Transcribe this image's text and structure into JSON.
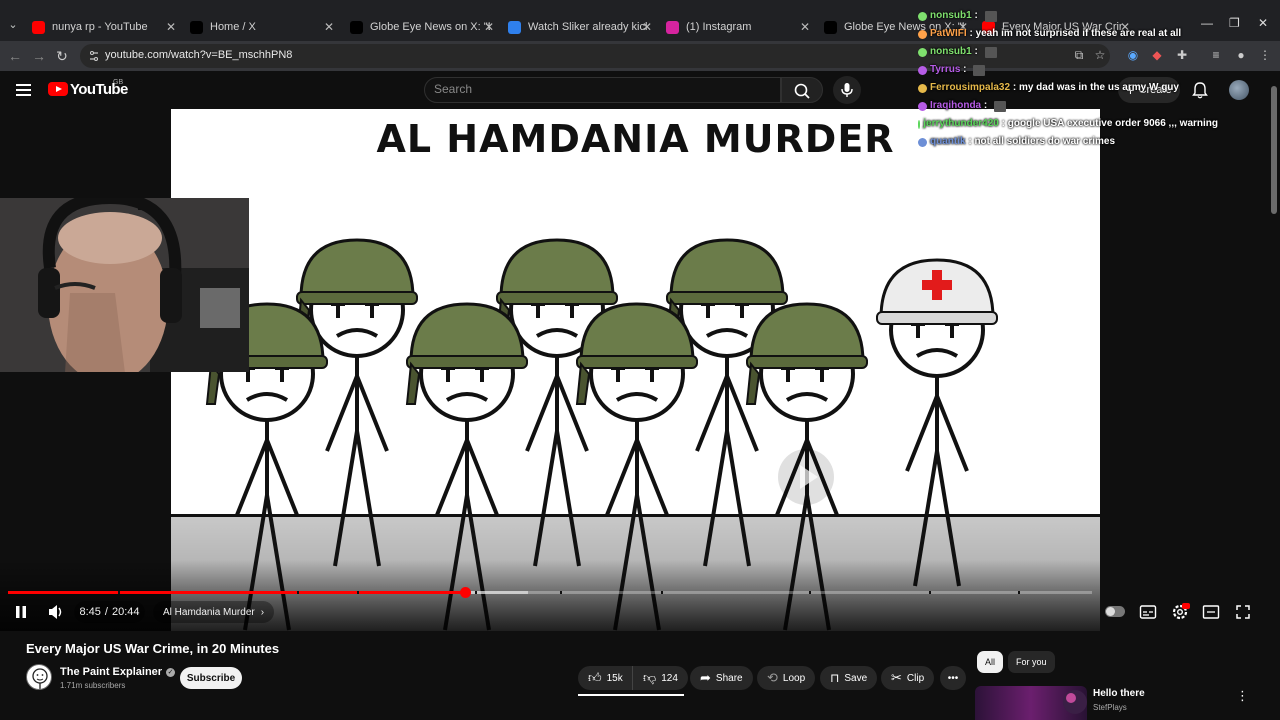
{
  "browser": {
    "tabs": [
      {
        "label": "nunya rp - YouTube",
        "icon": "youtube-icon",
        "color": "#ff0000"
      },
      {
        "label": "Home / X",
        "icon": "x-icon",
        "color": "#000000"
      },
      {
        "label": "Globe Eye News on X: \"BREAKI",
        "icon": "x-icon",
        "color": "#000000"
      },
      {
        "label": "Watch Sliker already kicked out",
        "icon": "kick-icon",
        "color": "#2f80ed"
      },
      {
        "label": "(1) Instagram",
        "icon": "instagram-icon",
        "color": "#d6249f"
      },
      {
        "label": "Globe Eye News on X: \"Preside",
        "icon": "x-icon",
        "color": "#000000"
      },
      {
        "label": "Every Major US War Crime",
        "icon": "youtube-icon",
        "color": "#ff0000"
      }
    ],
    "url": "youtube.com/watch?v=BE_mschhPN8"
  },
  "youtube": {
    "logo_text": "YouTube",
    "country_code": "GB",
    "search_placeholder": "Search",
    "create_label": "Create"
  },
  "video": {
    "frame_title": "AL HAMDANIA MURDER",
    "time_current": "8:45",
    "time_separator": "/",
    "time_total": "20:44",
    "chapter": "Al Hamdania Murder",
    "progress_fraction": 0.4218,
    "buffered_fraction": 0.48,
    "accent": "#ff0000"
  },
  "chat": [
    {
      "user": "nonsub1",
      "color": "#7fe06e",
      "message": "",
      "emote": true
    },
    {
      "user": "PatWIFI",
      "color": "#ffa24a",
      "message": "yeah im not surprised if these are real at all",
      "emote": false
    },
    {
      "user": "nonsub1",
      "color": "#7fe06e",
      "message": "",
      "emote": true
    },
    {
      "user": "Tyrrus",
      "color": "#b65ce6",
      "message": "",
      "emote": true
    },
    {
      "user": "Ferrousimpala32",
      "color": "#e6b94a",
      "message": "my dad was in the us army W guy",
      "emote": false
    },
    {
      "user": "Iraqihonda",
      "color": "#b65ce6",
      "message": "",
      "emote": true
    },
    {
      "user": "jerrythunder420",
      "color": "#5bd65b",
      "message": "google USA executive order 9066 ,,, warning",
      "emote": false
    },
    {
      "user": "quantik",
      "color": "#6d8fd6",
      "message": "not all soldiers do war crimes",
      "emote": false
    }
  ],
  "details": {
    "title": "Every Major US War Crime, in 20 Minutes",
    "channel": "The Paint Explainer",
    "subscribers": "1.71m subscribers",
    "subscribe_label": "Subscribe",
    "likes": "15k",
    "dislikes": "124",
    "share_label": "Share",
    "loop_label": "Loop",
    "save_label": "Save",
    "clip_label": "Clip",
    "chips": [
      "All",
      "For you"
    ],
    "rec_title": "Hello there",
    "rec_channel": "StefPlays"
  }
}
